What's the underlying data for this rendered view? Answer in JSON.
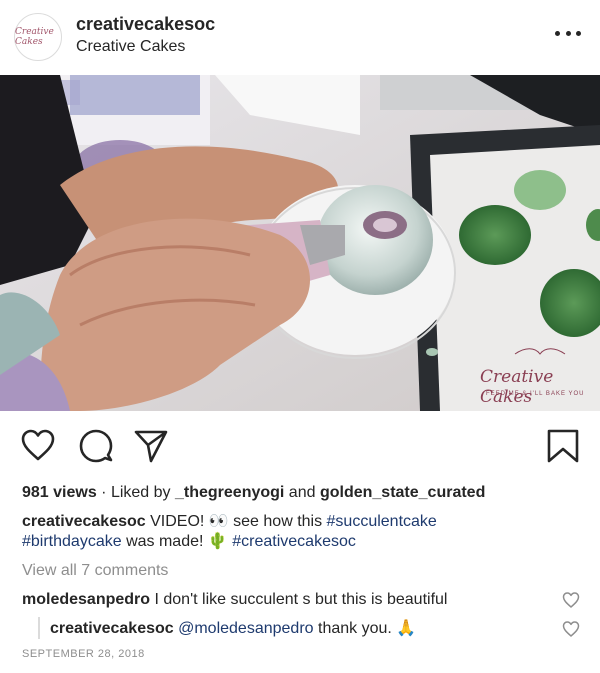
{
  "header": {
    "avatar_text": "Creative Cakes",
    "username": "creativecakesoc",
    "subtitle": "Creative Cakes",
    "more_icon": "more-horizontal-icon"
  },
  "media": {
    "watermark_text": "Creative Cakes",
    "watermark_sub": "FEED ME & I'LL BAKE YOU"
  },
  "actions": {
    "icons": [
      "heart-icon",
      "comment-icon",
      "share-icon",
      "bookmark-icon"
    ]
  },
  "stats": {
    "views": "981 views",
    "separator": " · Liked by ",
    "liker1": "_thegreenyogi",
    "and": " and ",
    "liker2": "golden_state_curated"
  },
  "caption": {
    "username": "creativecakesoc",
    "text1": " VIDEO! 👀 see how this ",
    "hashtag1": "#succulentcake",
    "hashtag2": "#birthdaycake",
    "text2": " was made! 🌵 ",
    "hashtag3": "#creativecakesoc"
  },
  "comments": {
    "view_all": "View all 7 comments",
    "items": [
      {
        "username": "moledesanpedro",
        "text": " I don't like succulent s but this is beautiful"
      },
      {
        "username": "creativecakesoc",
        "mention": "@moledesanpedro",
        "text": " thank you. 🙏"
      }
    ]
  },
  "date": "SEPTEMBER 28, 2018",
  "colors": {
    "text": "#262626",
    "link": "#1e3a6e",
    "muted": "#8e8e8e",
    "brand": "#8a3f53"
  }
}
